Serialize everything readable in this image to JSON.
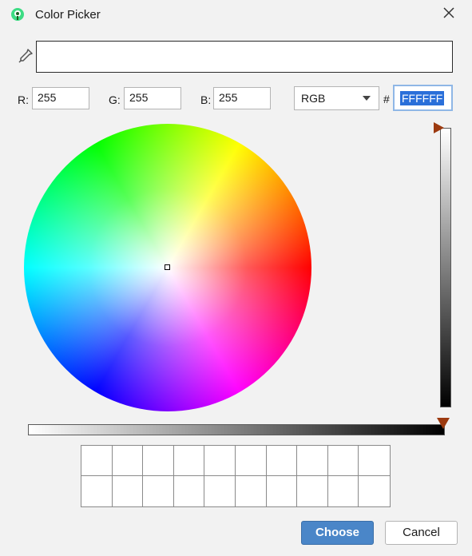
{
  "window": {
    "title": "Color Picker",
    "icon": "app-logo-icon",
    "close_icon": "close-icon"
  },
  "preview": {
    "color": "#FFFFFF",
    "eyedropper_icon": "eyedropper-icon"
  },
  "rgb": {
    "r_label": "R:",
    "r_value": "255",
    "g_label": "G:",
    "g_value": "255",
    "b_label": "B:",
    "b_value": "255"
  },
  "mode": {
    "selected": "RGB"
  },
  "hex": {
    "label": "#",
    "value": "FFFFFF"
  },
  "brightness": {
    "level": 1.0
  },
  "swatches": {
    "rows": 2,
    "columns": 10
  },
  "buttons": {
    "choose": "Choose",
    "cancel": "Cancel"
  },
  "colors": {
    "accent": "#4a86c8",
    "thumb": "#9c3a10",
    "selection": "#2a6fd9"
  }
}
